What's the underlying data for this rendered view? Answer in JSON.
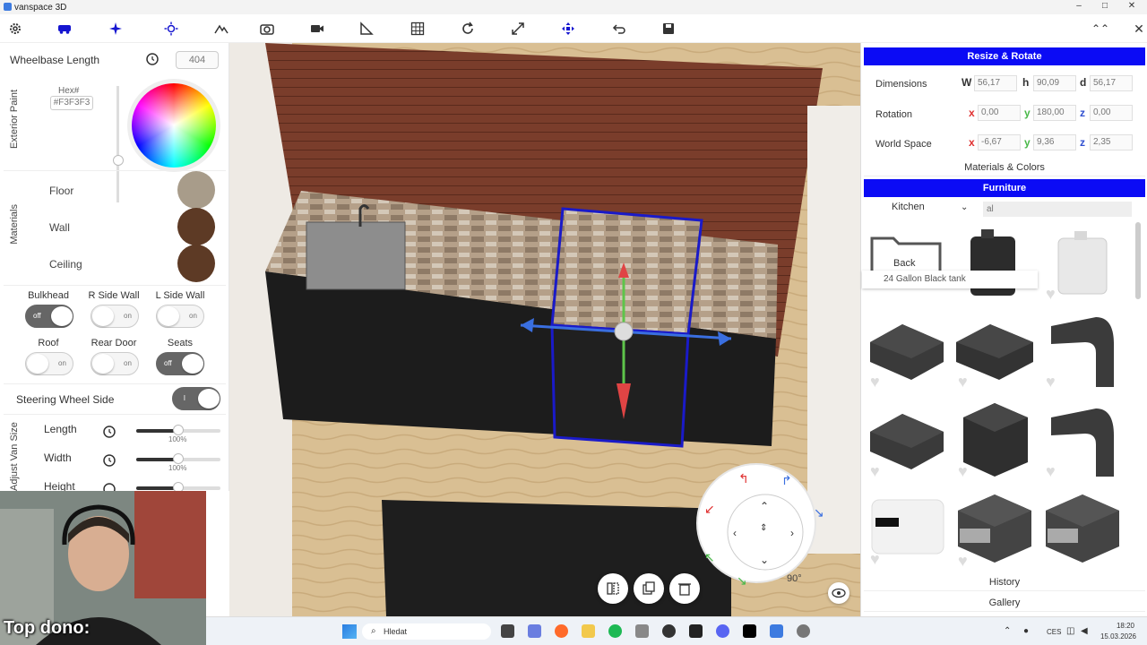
{
  "window": {
    "title": "vanspace 3D",
    "minimize": "–",
    "maximize": "□",
    "close": "✕"
  },
  "toolbar": {
    "icons": [
      "gear-icon",
      "van-icon",
      "sparkle-icon",
      "sun-icon",
      "mountain-icon",
      "camera-icon",
      "video-icon",
      "measure-icon",
      "grid-icon",
      "refresh-icon",
      "expand-icon",
      "move-icon",
      "undo-icon",
      "save-icon"
    ],
    "collapse": "⌃⌃",
    "close": "✕"
  },
  "left": {
    "wheelbase_label": "Wheelbase Length",
    "wheelbase_value": "404",
    "exterior_label": "Exterior Paint",
    "hex_label": "Hex#",
    "hex_value": "#F3F3F3",
    "materials_label": "Materials",
    "materials": [
      {
        "label": "Floor",
        "color": "#a89c8a"
      },
      {
        "label": "Wall",
        "color": "#5d3a25"
      },
      {
        "label": "Ceiling",
        "color": "#5d3a25"
      }
    ],
    "toggles": [
      {
        "label": "Bulkhead",
        "state": "off"
      },
      {
        "label": "R Side Wall",
        "state": "on"
      },
      {
        "label": "L Side Wall",
        "state": "on"
      },
      {
        "label": "Roof",
        "state": "on"
      },
      {
        "label": "Rear Door",
        "state": "on"
      },
      {
        "label": "Seats",
        "state": "off"
      }
    ],
    "steering_label": "Steering Wheel Side",
    "steering_state": "l",
    "adjust_label": "Adjust Van Size",
    "sliders": [
      {
        "label": "Length",
        "pct_text": "100%",
        "value": 0.5
      },
      {
        "label": "Width",
        "pct_text": "100%",
        "value": 0.5
      },
      {
        "label": "Height",
        "pct_text": "",
        "value": 0.5
      }
    ]
  },
  "stream": {
    "dono_label": "Top dono:"
  },
  "right": {
    "resize_header": "Resize & Rotate",
    "dimensions": {
      "label": "Dimensions",
      "w_label": "W",
      "h_label": "h",
      "d_label": "d",
      "w": "56,17",
      "h": "90,09",
      "d": "56,17"
    },
    "rotation": {
      "label": "Rotation",
      "x_label": "x",
      "y_label": "y",
      "z_label": "z",
      "x": "0,00",
      "y": "180,00",
      "z": "0,00"
    },
    "world": {
      "label": "World Space",
      "x_label": "x",
      "y_label": "y",
      "z_label": "z",
      "x": "-6,67",
      "y": "9,36",
      "z": "2,35"
    },
    "materials_colors": "Materials & Colors",
    "furniture_header": "Furniture",
    "category": "Kitchen",
    "search_value": "al",
    "back_label": "Back",
    "tooltip": "24 Gallon Black tank",
    "history": "History",
    "gallery": "Gallery"
  },
  "gizmo": {
    "angle": "90°"
  },
  "taskbar": {
    "search_placeholder": "Hledat",
    "lang": "CES",
    "time": "18:20",
    "date": "15.03.2026"
  }
}
